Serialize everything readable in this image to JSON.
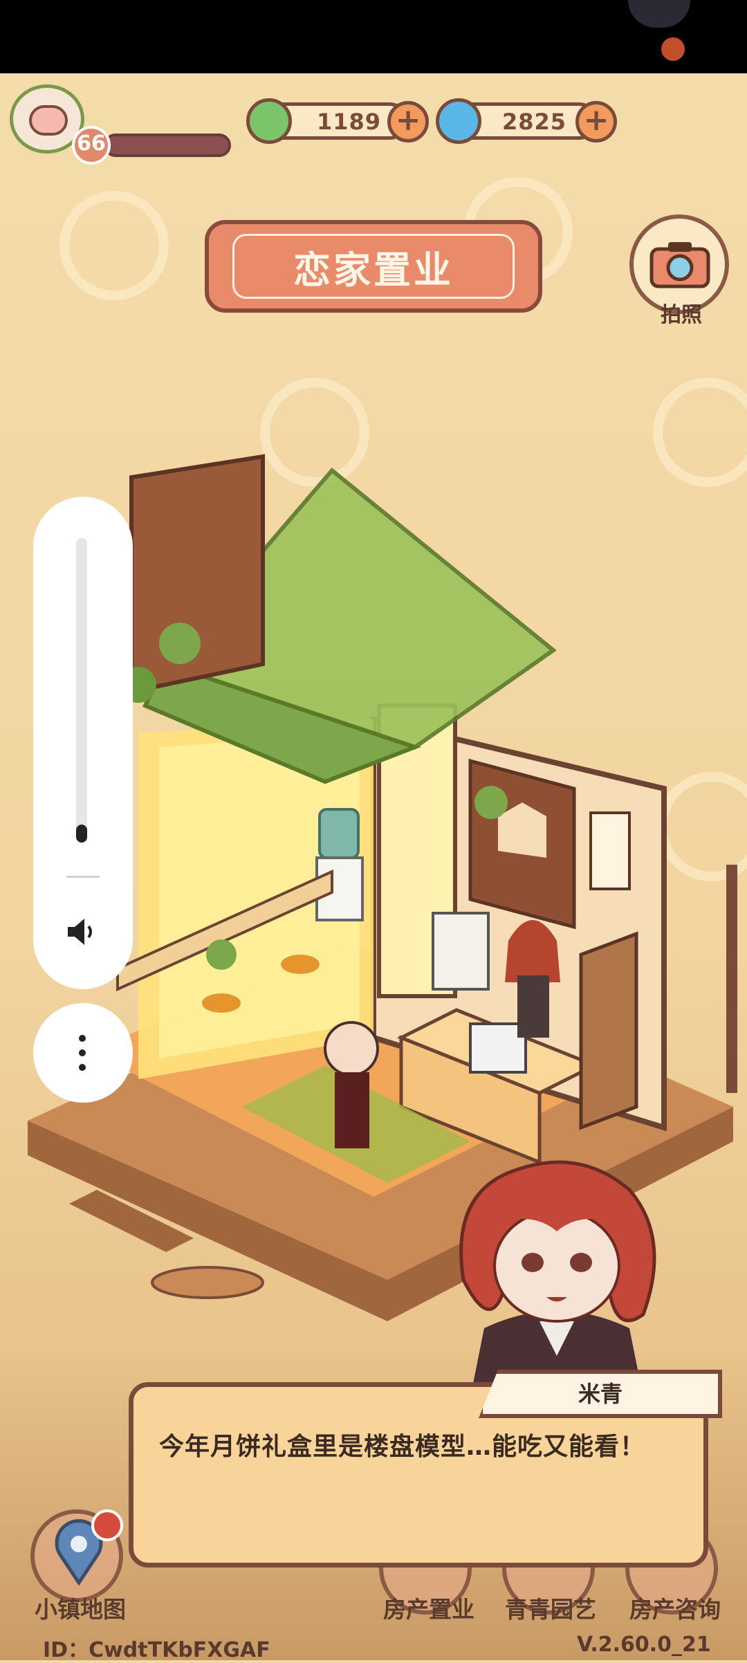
{
  "resources": {
    "leaf": {
      "value": "1189",
      "icon": "leaf-coin-icon"
    },
    "swirl": {
      "value": "2825",
      "icon": "swirl-gem-icon"
    }
  },
  "player": {
    "level": "66"
  },
  "scene": {
    "title": "恋家置业"
  },
  "camera": {
    "label": "拍照"
  },
  "dialog": {
    "speaker": "米青",
    "text": "今年月饼礼盒里是楼盘模型…能吃又能看！"
  },
  "nav": {
    "map_label": "小镇地图",
    "realty_label": "房产置业",
    "garden_label": "青青园艺",
    "consult_label": "房产咨询"
  },
  "footer": {
    "id_text": "ID：CwdtTKbFXGAF",
    "version": "V.2.60.0_21"
  },
  "colors": {
    "background": "#f3d9a6",
    "accent": "#e98a6b",
    "outline": "#7a4b3a"
  }
}
